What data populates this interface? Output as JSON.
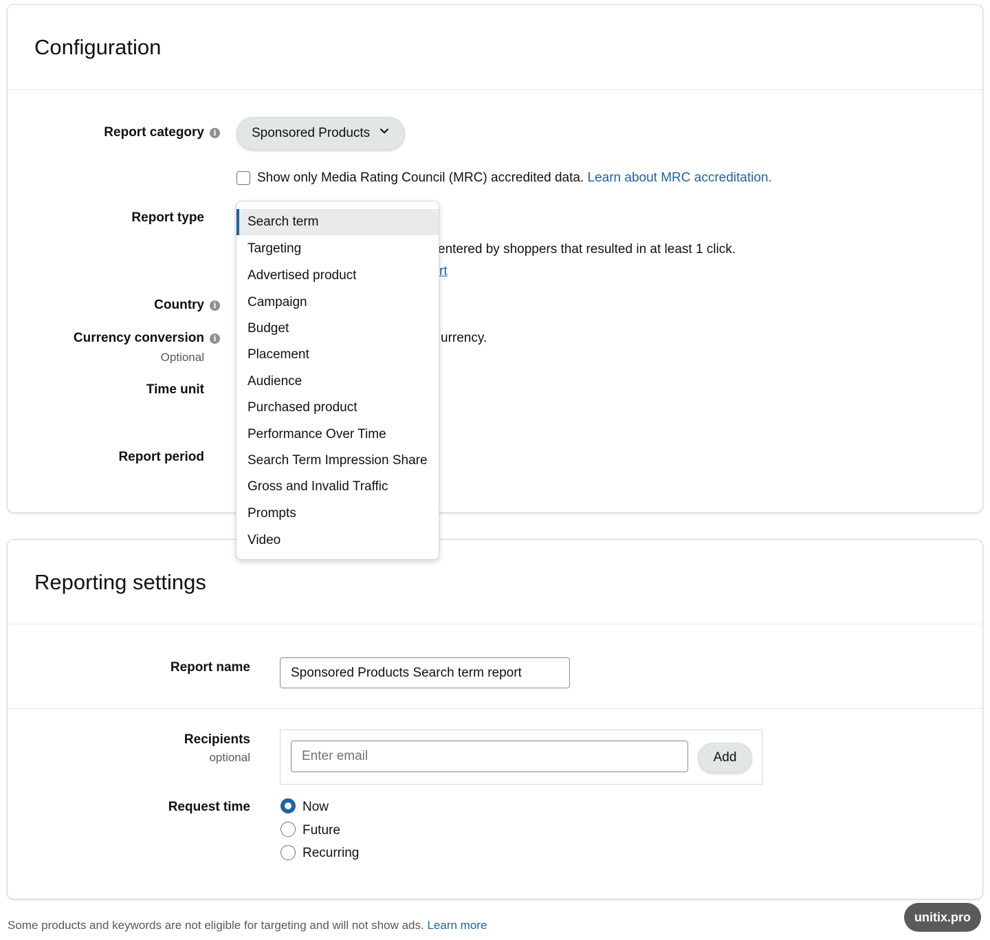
{
  "configuration": {
    "title": "Configuration",
    "report_category": {
      "label": "Report category",
      "selected": "Sponsored Products"
    },
    "mrc": {
      "text": "Show only Media Rating Council (MRC) accredited data.",
      "link": "Learn about MRC accreditation."
    },
    "report_type": {
      "label": "Report type",
      "description_fragment": "entered by shoppers that resulted in at least 1 click.",
      "link_fragment": "rt",
      "options": [
        "Search term",
        "Targeting",
        "Advertised product",
        "Campaign",
        "Budget",
        "Placement",
        "Audience",
        "Purchased product",
        "Performance Over Time",
        "Search Term Impression Share",
        "Gross and Invalid Traffic",
        "Prompts",
        "Video"
      ],
      "selected_index": 0
    },
    "country": {
      "label": "Country"
    },
    "currency_conversion": {
      "label": "Currency conversion",
      "optional": "Optional",
      "text_fragment": "urrency."
    },
    "time_unit": {
      "label": "Time unit"
    },
    "report_period": {
      "label": "Report period"
    }
  },
  "reporting_settings": {
    "title": "Reporting settings",
    "report_name": {
      "label": "Report name",
      "value": "Sponsored Products Search term report"
    },
    "recipients": {
      "label": "Recipients",
      "optional": "optional",
      "placeholder": "Enter email",
      "add_label": "Add"
    },
    "request_time": {
      "label": "Request time",
      "options": [
        "Now",
        "Future",
        "Recurring"
      ],
      "selected": "Now"
    }
  },
  "footer": {
    "text": "Some products and keywords are not eligible for targeting and will not show ads.",
    "link": "Learn more"
  },
  "watermark": "unitix.pro",
  "colors": {
    "link": "#2162a1",
    "selected_border": "#2162a1"
  }
}
